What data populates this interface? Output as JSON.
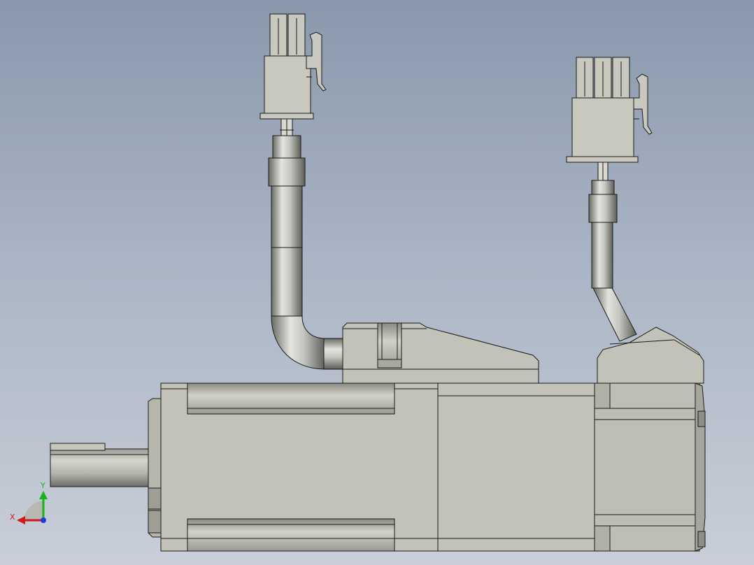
{
  "viewport": {
    "background_top": "#8a98ac",
    "background_bottom": "#c9ced8",
    "view": "front"
  },
  "model": {
    "name": "",
    "parts": [
      "motor-shaft",
      "shaft-key",
      "front-flange",
      "motor-body",
      "encoder-housing",
      "power-cable",
      "power-connector",
      "encoder-cable",
      "encoder-connector",
      "cable-outlet-block"
    ],
    "colors": {
      "body": "#c2c2b8",
      "body_dark": "#8e8e86",
      "edge": "#1a1a1a",
      "metal_light": "#e2e2dc",
      "metal_dark": "#6a6a64"
    }
  },
  "triad": {
    "x_label": "X",
    "y_label": "Y",
    "x_color": "#d21a1a",
    "y_color": "#17b317",
    "z_color": "#1a3fd2"
  }
}
